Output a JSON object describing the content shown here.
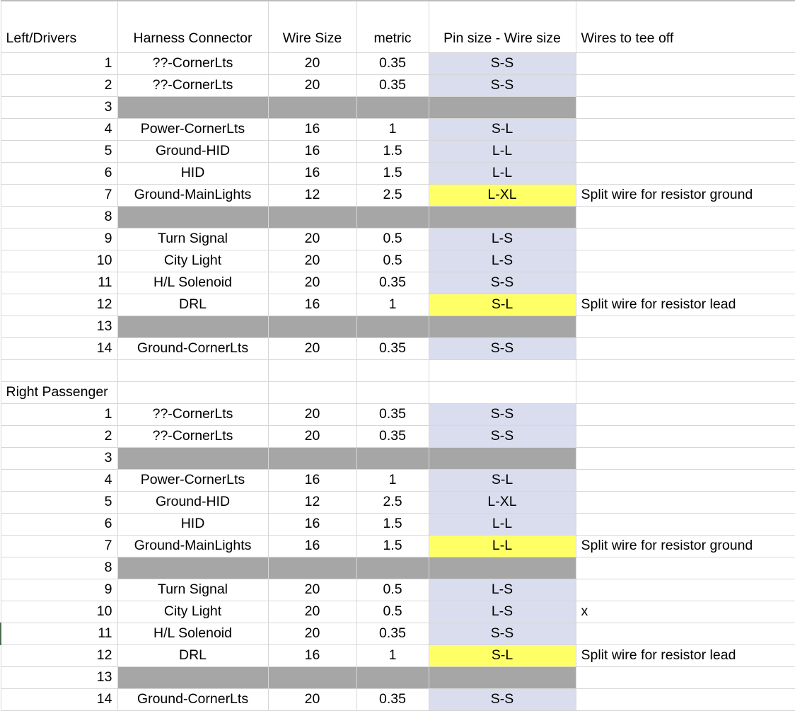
{
  "table": {
    "columns": [
      {
        "key": "idx",
        "label": "Left/Drivers",
        "align": "left"
      },
      {
        "key": "harn",
        "label": "Harness Connector",
        "align": "center"
      },
      {
        "key": "wire",
        "label": "Wire Size",
        "align": "center"
      },
      {
        "key": "metric",
        "label": "metric",
        "align": "center"
      },
      {
        "key": "pin",
        "label": "Pin size - Wire size",
        "align": "center"
      },
      {
        "key": "tee",
        "label": "Wires to tee off",
        "align": "left"
      }
    ],
    "colors": {
      "gray_fill": "#a6a6a6",
      "blue_fill": "#d9dded",
      "yellow_fill": "#ffff66",
      "gridline": "#d7d7d7",
      "text": "#000000"
    },
    "rows": [
      {
        "type": "header",
        "idx": "Left/Drivers",
        "harn": "Harness Connector",
        "wire": "Wire Size",
        "metric": "metric",
        "pin": "Pin size - Wire size",
        "tee": "Wires to tee off"
      },
      {
        "type": "data",
        "idx": "1",
        "harn": "??-CornerLts",
        "wire": "20",
        "metric": "0.35",
        "pin": "S-S",
        "tee": "",
        "pin_fill": "blue"
      },
      {
        "type": "data",
        "idx": "2",
        "harn": "??-CornerLts",
        "wire": "20",
        "metric": "0.35",
        "pin": "S-S",
        "tee": "",
        "pin_fill": "blue"
      },
      {
        "type": "blocked",
        "idx": "3",
        "harn": "",
        "wire": "",
        "metric": "",
        "pin": "",
        "tee": ""
      },
      {
        "type": "data",
        "idx": "4",
        "harn": "Power-CornerLts",
        "wire": "16",
        "metric": "1",
        "pin": "S-L",
        "tee": "",
        "pin_fill": "blue"
      },
      {
        "type": "data",
        "idx": "5",
        "harn": "Ground-HID",
        "wire": "16",
        "metric": "1.5",
        "pin": "L-L",
        "tee": "",
        "pin_fill": "blue"
      },
      {
        "type": "data",
        "idx": "6",
        "harn": "HID",
        "wire": "16",
        "metric": "1.5",
        "pin": "L-L",
        "tee": "",
        "pin_fill": "blue"
      },
      {
        "type": "data",
        "idx": "7",
        "harn": "Ground-MainLights",
        "wire": "12",
        "metric": "2.5",
        "pin": "L-XL",
        "tee": "Split wire for resistor ground",
        "pin_fill": "yellow"
      },
      {
        "type": "blocked",
        "idx": "8",
        "harn": "",
        "wire": "",
        "metric": "",
        "pin": "",
        "tee": ""
      },
      {
        "type": "data",
        "idx": "9",
        "harn": "Turn Signal",
        "wire": "20",
        "metric": "0.5",
        "pin": "L-S",
        "tee": "",
        "pin_fill": "blue"
      },
      {
        "type": "data",
        "idx": "10",
        "harn": "City Light",
        "wire": "20",
        "metric": "0.5",
        "pin": "L-S",
        "tee": "",
        "pin_fill": "blue"
      },
      {
        "type": "data",
        "idx": "11",
        "harn": "H/L Solenoid",
        "wire": "20",
        "metric": "0.35",
        "pin": "S-S",
        "tee": "",
        "pin_fill": "blue"
      },
      {
        "type": "data",
        "idx": "12",
        "harn": "DRL",
        "wire": "16",
        "metric": "1",
        "pin": "S-L",
        "tee": "Split wire for resistor lead",
        "pin_fill": "yellow"
      },
      {
        "type": "blocked",
        "idx": "13",
        "harn": "",
        "wire": "",
        "metric": "",
        "pin": "",
        "tee": ""
      },
      {
        "type": "data",
        "idx": "14",
        "harn": "Ground-CornerLts",
        "wire": "20",
        "metric": "0.35",
        "pin": "S-S",
        "tee": "",
        "pin_fill": "blue"
      },
      {
        "type": "spacer",
        "idx": "",
        "harn": "",
        "wire": "",
        "metric": "",
        "pin": "",
        "tee": ""
      },
      {
        "type": "section",
        "idx": "Right Passenger",
        "harn": "",
        "wire": "",
        "metric": "",
        "pin": "",
        "tee": ""
      },
      {
        "type": "data",
        "idx": "1",
        "harn": "??-CornerLts",
        "wire": "20",
        "metric": "0.35",
        "pin": "S-S",
        "tee": "",
        "pin_fill": "blue"
      },
      {
        "type": "data",
        "idx": "2",
        "harn": "??-CornerLts",
        "wire": "20",
        "metric": "0.35",
        "pin": "S-S",
        "tee": "",
        "pin_fill": "blue"
      },
      {
        "type": "blocked",
        "idx": "3",
        "harn": "",
        "wire": "",
        "metric": "",
        "pin": "",
        "tee": ""
      },
      {
        "type": "data",
        "idx": "4",
        "harn": "Power-CornerLts",
        "wire": "16",
        "metric": "1",
        "pin": "S-L",
        "tee": "",
        "pin_fill": "blue"
      },
      {
        "type": "data",
        "idx": "5",
        "harn": "Ground-HID",
        "wire": "12",
        "metric": "2.5",
        "pin": "L-XL",
        "tee": "",
        "pin_fill": "blue"
      },
      {
        "type": "data",
        "idx": "6",
        "harn": "HID",
        "wire": "16",
        "metric": "1.5",
        "pin": "L-L",
        "tee": "",
        "pin_fill": "blue"
      },
      {
        "type": "data",
        "idx": "7",
        "harn": "Ground-MainLights",
        "wire": "16",
        "metric": "1.5",
        "pin": "L-L",
        "tee": "Split wire for resistor ground",
        "pin_fill": "yellow"
      },
      {
        "type": "blocked",
        "idx": "8",
        "harn": "",
        "wire": "",
        "metric": "",
        "pin": "",
        "tee": ""
      },
      {
        "type": "data",
        "idx": "9",
        "harn": "Turn Signal",
        "wire": "20",
        "metric": "0.5",
        "pin": "L-S",
        "tee": "",
        "pin_fill": "blue"
      },
      {
        "type": "data",
        "idx": "10",
        "harn": "City Light",
        "wire": "20",
        "metric": "0.5",
        "pin": "L-S",
        "tee": "x",
        "pin_fill": "blue"
      },
      {
        "type": "data",
        "idx": "11",
        "harn": "H/L Solenoid",
        "wire": "20",
        "metric": "0.35",
        "pin": "S-S",
        "tee": "",
        "pin_fill": "blue",
        "selected": true
      },
      {
        "type": "data",
        "idx": "12",
        "harn": "DRL",
        "wire": "16",
        "metric": "1",
        "pin": "S-L",
        "tee": "Split wire for resistor lead",
        "pin_fill": "yellow"
      },
      {
        "type": "blocked",
        "idx": "13",
        "harn": "",
        "wire": "",
        "metric": "",
        "pin": "",
        "tee": ""
      },
      {
        "type": "data",
        "idx": "14",
        "harn": "Ground-CornerLts",
        "wire": "20",
        "metric": "0.35",
        "pin": "S-S",
        "tee": "",
        "pin_fill": "blue"
      }
    ]
  }
}
